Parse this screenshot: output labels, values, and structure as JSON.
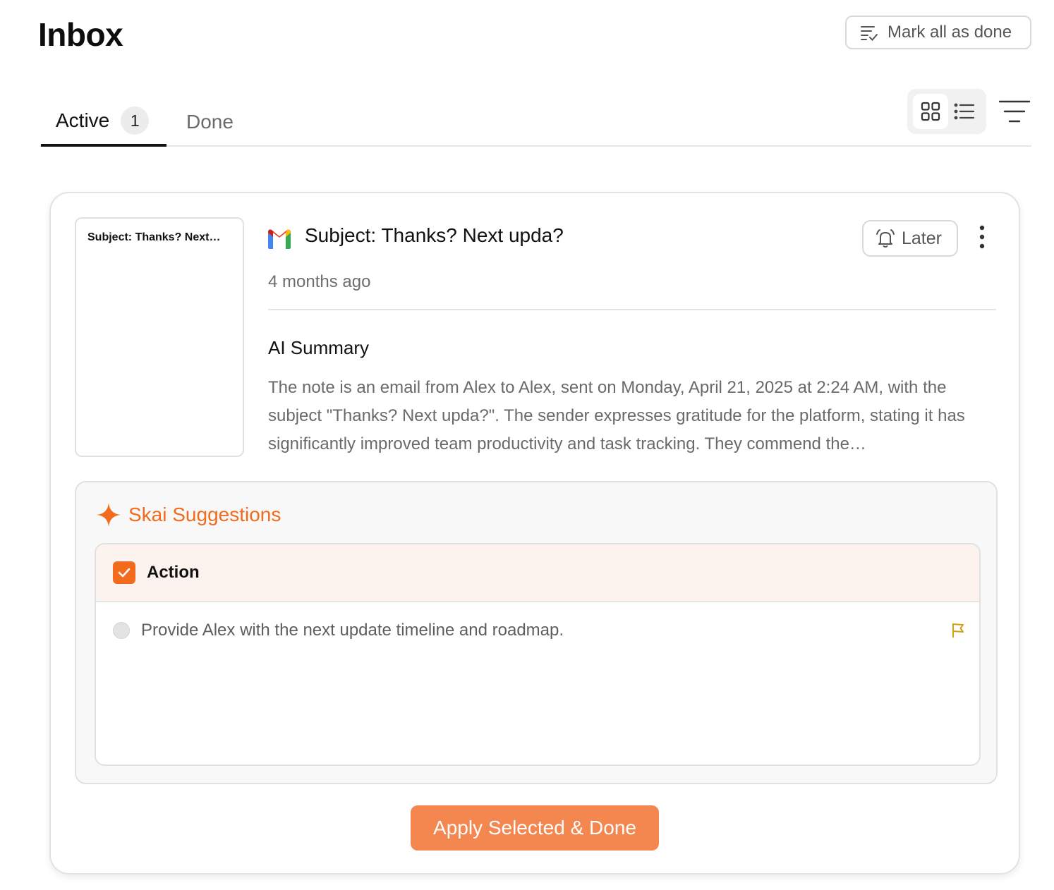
{
  "header": {
    "title": "Inbox",
    "mark_all_label": "Mark all as done",
    "mark_all_icon": "list-check-icon"
  },
  "tabs": [
    {
      "label": "Active",
      "count": "1",
      "selected": true
    },
    {
      "label": "Done",
      "selected": false
    }
  ],
  "view_toggle": {
    "options": [
      "grid-icon",
      "list-icon"
    ],
    "selected": "grid-icon"
  },
  "filter_icon": "filter-icon",
  "card": {
    "thumbnail_text": "Subject: Thanks? Next…",
    "source_icon": "gmail-icon",
    "subject": "Subject: Thanks? Next upda?",
    "later_label": "Later",
    "later_icon": "bell-icon",
    "time_ago": "4 months ago",
    "summary_heading": "AI Summary",
    "summary_text": "The note is an email from Alex to Alex, sent on Monday, April 21, 2025 at 2:24 AM, with the subject \"Thanks? Next upda?\". The sender expresses gratitude for the platform, stating it has significantly improved team productivity and task tracking. They commend the…",
    "suggestions": {
      "title": "Skai Suggestions",
      "icon": "sparkle-icon",
      "group_label": "Action",
      "group_checked": true,
      "items": [
        {
          "text": "Provide Alex with the next update timeline and roadmap.",
          "selected": false,
          "flag_icon": "flag-icon"
        }
      ]
    },
    "apply_label": "Apply Selected & Done"
  },
  "colors": {
    "accent": "#f26b1d",
    "apply_button": "#f4874f",
    "action_header_bg": "#fdf3ee",
    "flag": "#d4a017"
  }
}
